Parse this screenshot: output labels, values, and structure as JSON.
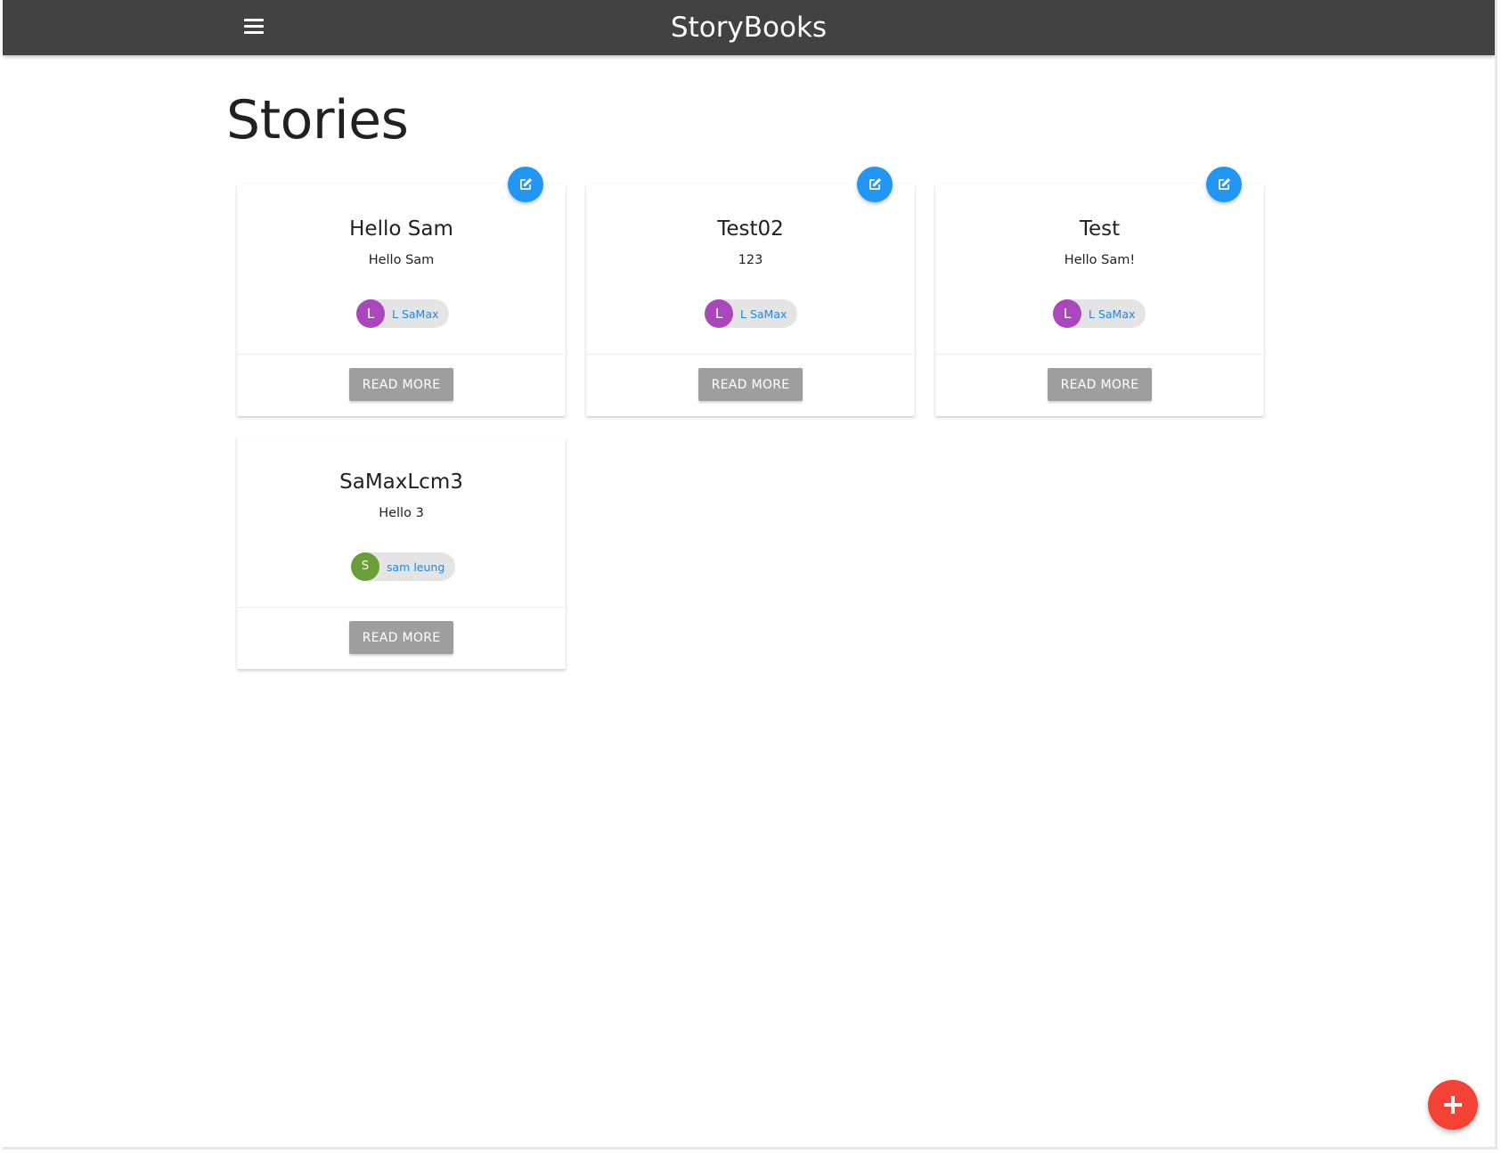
{
  "app": {
    "brand": "StoryBooks"
  },
  "main": {
    "title": "Stories"
  },
  "colors": {
    "navbar": "#424242",
    "accent_blue": "#2196f3",
    "fab_red": "#f44336",
    "button_grey": "#9e9e9e",
    "link_blue": "#1e88e5",
    "avatar_purple": "#ab47bc",
    "avatar_green": "#689f38"
  },
  "icons": {
    "menu": "menu-icon",
    "edit": "edit-icon",
    "add": "plus-icon"
  },
  "stories": [
    {
      "title": "Hello Sam",
      "body": "Hello Sam",
      "author_initial": "L",
      "author_name": "L SaMax",
      "avatar_color": "#ab47bc",
      "read_more_label": "READ MORE",
      "editable": true
    },
    {
      "title": "Test02",
      "body": "123",
      "author_initial": "L",
      "author_name": "L SaMax",
      "avatar_color": "#ab47bc",
      "read_more_label": "READ MORE",
      "editable": true
    },
    {
      "title": "Test",
      "body": "Hello Sam!",
      "author_initial": "L",
      "author_name": "L SaMax",
      "avatar_color": "#ab47bc",
      "read_more_label": "READ MORE",
      "editable": true
    },
    {
      "title": "SaMaxLcm3",
      "body": "Hello 3",
      "author_initial": "S",
      "author_name": "sam leung",
      "avatar_color": "#689f38",
      "read_more_label": "READ MORE",
      "editable": false
    }
  ]
}
